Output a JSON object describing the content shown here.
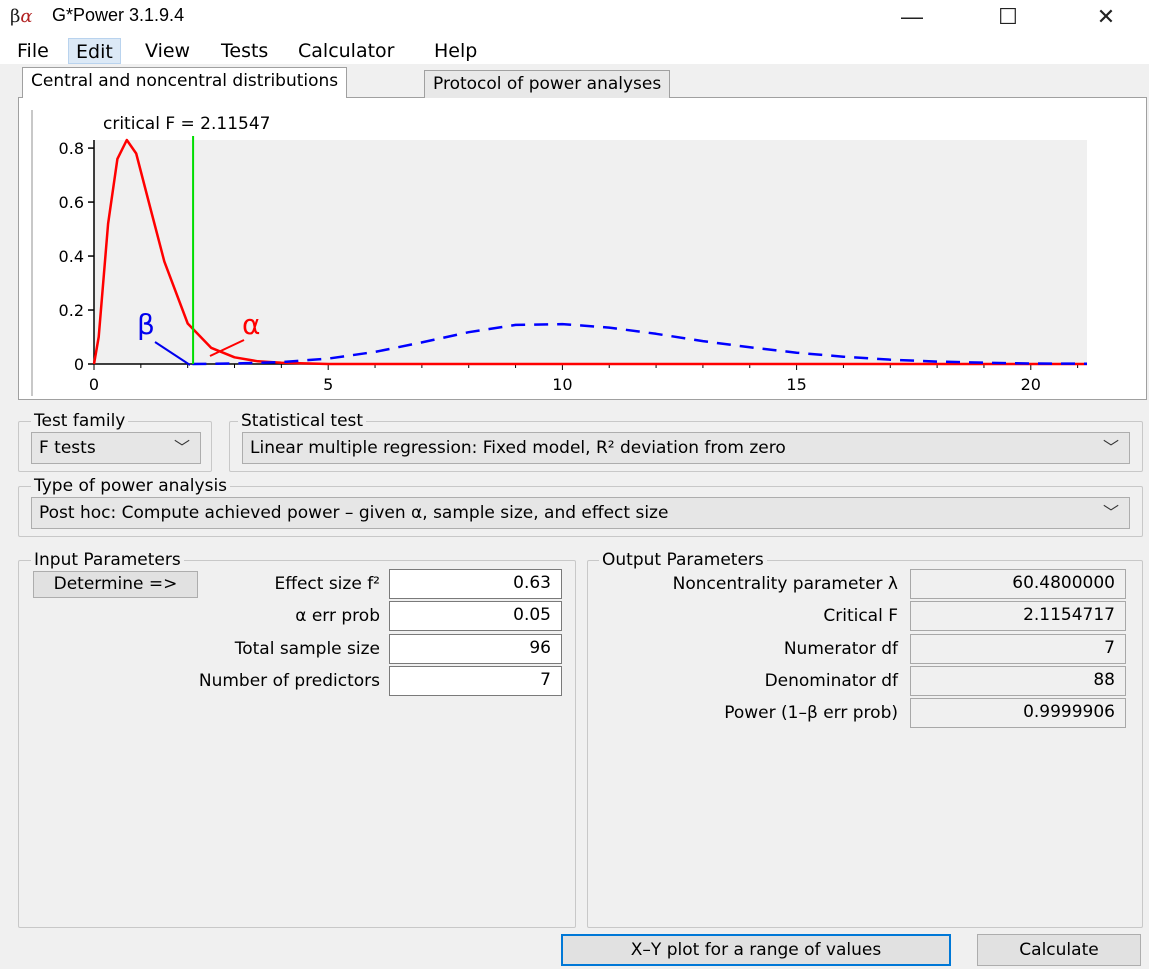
{
  "window": {
    "title": "G*Power 3.1.9.4",
    "icon_text_beta": "β",
    "icon_text_alpha": "α",
    "minimize": "—",
    "maximize": "☐",
    "close": "✕"
  },
  "menu": [
    "File",
    "Edit",
    "View",
    "Tests",
    "Calculator",
    "Help"
  ],
  "tabs": {
    "distributions": "Central and noncentral distributions",
    "protocol": "Protocol of power analyses"
  },
  "plot": {
    "critical_label": "critical F =  2.11547",
    "beta_symbol": "β",
    "alpha_symbol": "α",
    "y_ticks": [
      "0.8",
      "0.6",
      "0.4",
      "0.2",
      "0"
    ],
    "x_ticks": [
      "0",
      "5",
      "10",
      "15",
      "20"
    ]
  },
  "chart_data": {
    "type": "line",
    "title": "",
    "xlim": [
      0,
      21.2
    ],
    "ylim": [
      0,
      0.83
    ],
    "x_ticks": [
      0,
      5,
      10,
      15,
      20
    ],
    "y_ticks": [
      0,
      0.2,
      0.4,
      0.6,
      0.8
    ],
    "critical_F": 2.11547,
    "series": [
      {
        "color": "#ff0000",
        "style": "solid",
        "x": [
          0,
          0.1,
          0.3,
          0.5,
          0.7,
          0.9,
          1.2,
          1.5,
          2.0,
          2.5,
          3.0,
          3.5,
          4.0,
          5.0,
          21.2
        ],
        "y": [
          0,
          0.1,
          0.52,
          0.76,
          0.83,
          0.78,
          0.58,
          0.38,
          0.15,
          0.06,
          0.025,
          0.01,
          0.005,
          0.0,
          0.0
        ]
      },
      {
        "color": "#0000ff",
        "style": "dashed",
        "x": [
          2.1,
          3.0,
          4.0,
          5.0,
          6.0,
          7.0,
          8.0,
          9.0,
          10.0,
          11.0,
          12.0,
          13.0,
          14.0,
          15.0,
          16.0,
          17.0,
          18.0,
          19.0,
          20.0,
          21.2
        ],
        "y": [
          0.0,
          0.002,
          0.007,
          0.02,
          0.045,
          0.08,
          0.118,
          0.145,
          0.148,
          0.135,
          0.112,
          0.085,
          0.062,
          0.042,
          0.027,
          0.016,
          0.009,
          0.005,
          0.002,
          0.001
        ]
      }
    ]
  },
  "test_family": {
    "label": "Test family",
    "value": "F tests"
  },
  "statistical_test": {
    "label": "Statistical test",
    "value": "Linear multiple regression: Fixed model, R² deviation from zero"
  },
  "power_analysis": {
    "label": "Type of power analysis",
    "value": "Post hoc: Compute achieved power – given α, sample size, and effect size"
  },
  "input": {
    "title": "Input Parameters",
    "determine": "Determine =>",
    "params": [
      {
        "label": "Effect size f²",
        "value": "0.63"
      },
      {
        "label": "α err prob",
        "value": "0.05"
      },
      {
        "label": "Total sample size",
        "value": "96"
      },
      {
        "label": "Number of predictors",
        "value": "7"
      }
    ]
  },
  "output": {
    "title": "Output Parameters",
    "params": [
      {
        "label": "Noncentrality parameter λ",
        "value": "60.4800000"
      },
      {
        "label": "Critical F",
        "value": "2.1154717"
      },
      {
        "label": "Numerator df",
        "value": "7"
      },
      {
        "label": "Denominator df",
        "value": "88"
      },
      {
        "label": "Power (1–β err prob)",
        "value": "0.9999906"
      }
    ]
  },
  "buttons": {
    "xy_plot": "X–Y plot for a range of values",
    "calculate": "Calculate"
  }
}
